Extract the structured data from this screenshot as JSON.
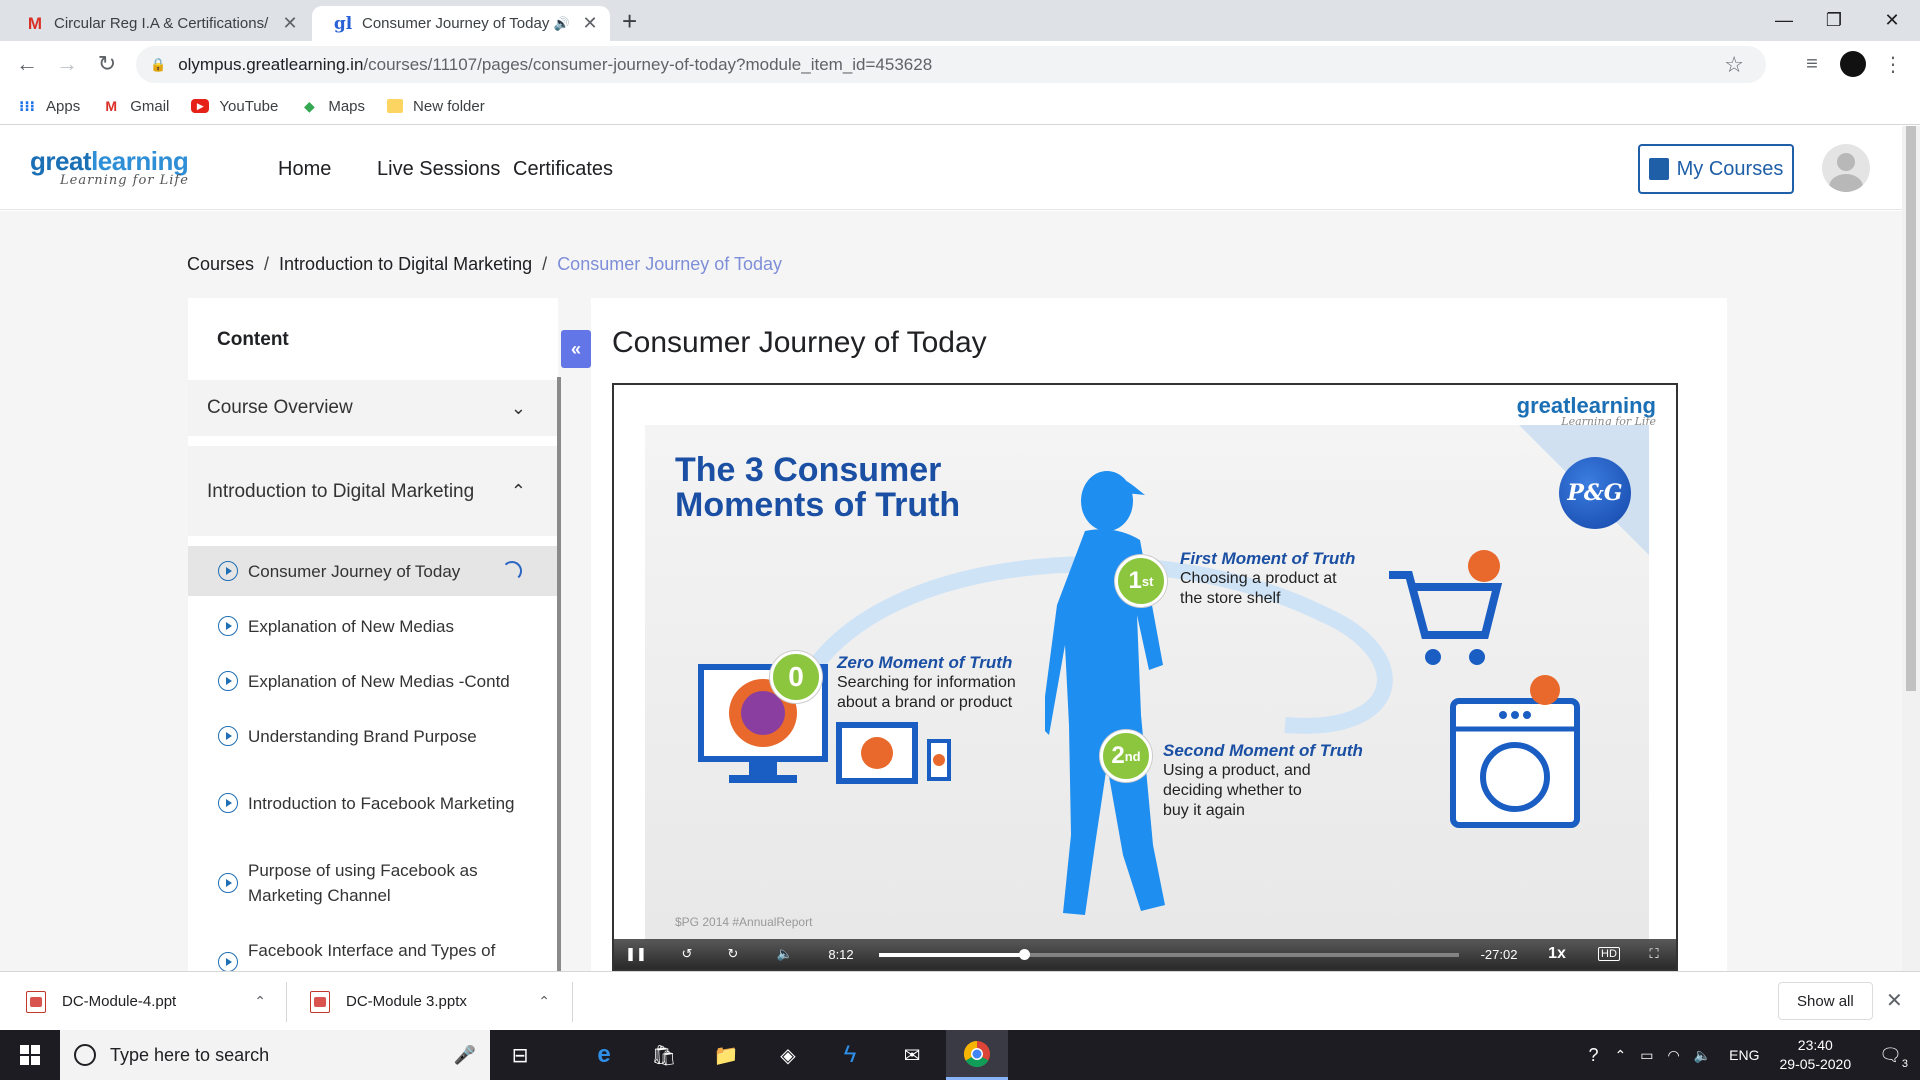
{
  "browser": {
    "tabs": [
      {
        "title": "Circular Reg I.A & Certifications/",
        "favicon": "M"
      },
      {
        "title": "Consumer Journey of Today",
        "favicon": "gl"
      }
    ],
    "url_host": "olympus.greatlearning.in",
    "url_path": "/courses/11107/pages/consumer-journey-of-today?module_item_id=453628",
    "bookmarks": [
      {
        "label": "Apps",
        "icon": "apps-grid-icon"
      },
      {
        "label": "Gmail",
        "icon": "gmail-icon"
      },
      {
        "label": "YouTube",
        "icon": "youtube-icon"
      },
      {
        "label": "Maps",
        "icon": "maps-icon"
      },
      {
        "label": "New folder",
        "icon": "folder-icon"
      }
    ]
  },
  "site": {
    "logo_main_a": "great",
    "logo_main_b": "learning",
    "logo_sub": "Learning for Life",
    "nav": [
      "Home",
      "Live Sessions",
      "Certificates"
    ],
    "my_courses": "My Courses"
  },
  "breadcrumb": {
    "items": [
      "Courses",
      "Introduction to Digital Marketing"
    ],
    "current": "Consumer Journey of Today",
    "separator": "/"
  },
  "sidebar": {
    "title": "Content",
    "collapse_glyph": "«",
    "sections": [
      {
        "label": "Course Overview",
        "chevron": "⌄"
      },
      {
        "label": "Introduction to Digital Marketing",
        "chevron": "⌃"
      }
    ],
    "lessons": [
      "Consumer Journey of Today",
      "Explanation of New Medias",
      "Explanation of New Medias -Contd",
      "Understanding Brand Purpose",
      "Introduction to Facebook Marketing",
      "Purpose of using Facebook as Marketing Channel",
      "Facebook Interface and Types of"
    ]
  },
  "lesson_title": "Consumer Journey of Today",
  "video": {
    "watermark_main": "greatlearning",
    "watermark_sub": "Learning for Life",
    "slide_title_1": "The 3 Consumer",
    "slide_title_2": "Moments of Truth",
    "brand_badge": "P&G",
    "moments": [
      {
        "num": "0",
        "sup": "",
        "heading": "Zero Moment of Truth",
        "line1": "Searching for information",
        "line2": "about a brand or product",
        "line3": ""
      },
      {
        "num": "1",
        "sup": "st",
        "heading": "First Moment of Truth",
        "line1": "Choosing a product at",
        "line2": "the store shelf",
        "line3": ""
      },
      {
        "num": "2",
        "sup": "nd",
        "heading": "Second Moment of Truth",
        "line1": "Using a product, and",
        "line2": "deciding whether to",
        "line3": "buy it again"
      }
    ],
    "footnote": "$PG 2014 #AnnualReport",
    "current_time": "8:12",
    "remaining_time": "-27:02",
    "speed": "1x",
    "progress": 0.25
  },
  "downloads": {
    "files": [
      "DC-Module-4.ppt",
      "DC-Module 3.pptx"
    ],
    "show_all": "Show all"
  },
  "taskbar": {
    "search_placeholder": "Type here to search",
    "lang": "ENG",
    "time": "23:40",
    "date": "29-05-2020",
    "notif_count": "3"
  },
  "colors": {
    "accent": "#1f5fa8",
    "breadcrumb_current": "#7e8ed8",
    "collapse_button": "#6276e8",
    "green_badge": "#8cc63f",
    "slide_blue": "#1a4fa3"
  }
}
